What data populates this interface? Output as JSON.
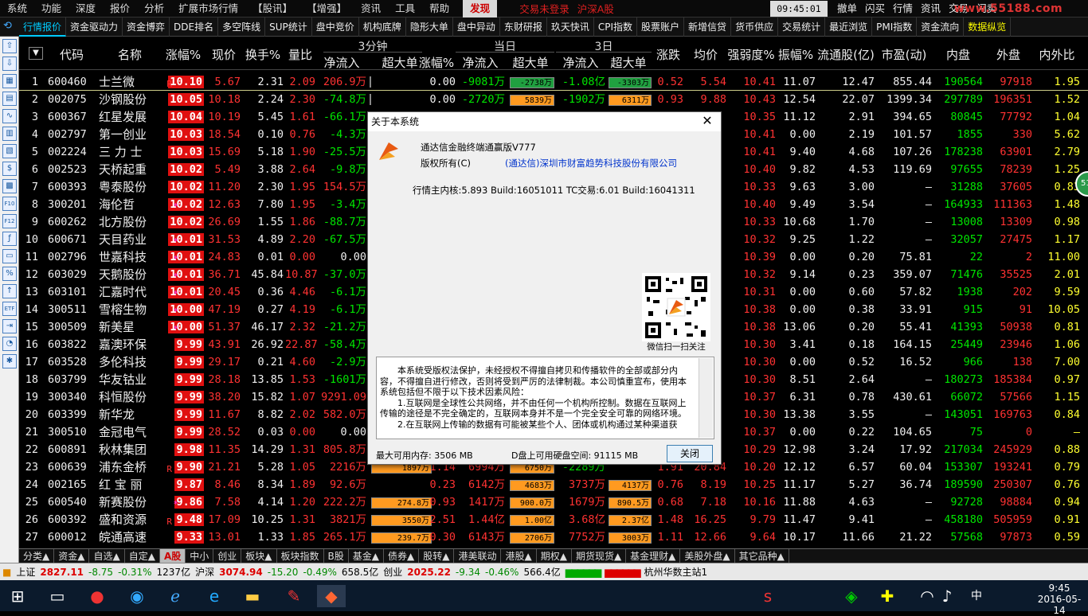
{
  "menubar": {
    "items": [
      "系统",
      "功能",
      "深度",
      "报价",
      "分析",
      "扩展市场行情",
      "【股讯】",
      "【增强】",
      "资讯",
      "工具",
      "帮助"
    ],
    "faxian": "发现",
    "status_login": "交易未登录",
    "status_market": "沪深A股",
    "clock": "09:45:01 周六",
    "right_buttons": [
      "撤单",
      "闪买",
      "行情",
      "资讯",
      "交易",
      "闪卖"
    ],
    "logo": "www.55188.com"
  },
  "tabs": [
    "行情报价",
    "资金驱动力",
    "资金博弈",
    "DDE排名",
    "多空阵线",
    "SUP统计",
    "盘中竞价",
    "机构底牌",
    "隐形大单",
    "盘中异动",
    "东财研报",
    "玖天快讯",
    "CPI指数",
    "股票账户",
    "新增信贷",
    "货币供应",
    "交易统计",
    "最近浏览",
    "PMI指数",
    "资金流向",
    "数据纵览"
  ],
  "left_icons": [
    "up-arrow",
    "down-arrow",
    "chart",
    "table",
    "line",
    "bars",
    "doc",
    "fund",
    "grid",
    "f10",
    "f12",
    "fdo",
    "folder",
    "ratio",
    "bars2",
    "etf",
    "exit",
    "hat",
    "gear"
  ],
  "groups": {
    "g3": "3分钟",
    "gday": "当日",
    "g3d": "3日"
  },
  "columns": [
    "代码",
    "名称",
    "涨幅%",
    "现价",
    "换手%",
    "量比",
    "净流入",
    "超大单",
    "涨幅%",
    "净流入",
    "超大单",
    "净流入",
    "超大单",
    "涨跌",
    "均价",
    "强弱度%",
    "振幅%",
    "流通股(亿)",
    "市盈(动)",
    "内盘",
    "外盘",
    "内外比"
  ],
  "rows": [
    {
      "n": "1",
      "code": "600460",
      "name": "士兰微",
      "flag": "R",
      "pct": "10.10",
      "price": "5.67",
      "turn": "2.31",
      "vr": "2.09",
      "in3": "206.9万",
      "big3": "",
      "p3": "0.00",
      "inD": "-9081万",
      "bigD": "-2738万",
      "in3d": "-1.08亿",
      "big3d": "-3303万",
      "chg": "0.52",
      "avg": "5.54",
      "str": "10.41",
      "amp": "11.07",
      "fl": "12.47",
      "pe": "855.44",
      "inner": "190564",
      "outer": "97918",
      "ratio": "1.95"
    },
    {
      "n": "2",
      "code": "002075",
      "name": "沙钢股份",
      "flag": "",
      "pct": "10.05",
      "price": "10.18",
      "turn": "2.24",
      "vr": "2.30",
      "in3": "-74.8万",
      "big3": "",
      "p3": "0.00",
      "inD": "-2720万",
      "bigD": "5839万",
      "in3d": "-1902万",
      "big3d": "6311万",
      "chg": "0.93",
      "avg": "9.88",
      "str": "10.43",
      "amp": "12.54",
      "fl": "22.07",
      "pe": "1399.34",
      "inner": "297789",
      "outer": "196351",
      "ratio": "1.52"
    },
    {
      "n": "3",
      "code": "600367",
      "name": "红星发展",
      "flag": "",
      "pct": "10.04",
      "price": "10.19",
      "turn": "5.45",
      "vr": "1.61",
      "in3": "-66.1万",
      "big3": "",
      "p3": "",
      "inD": "",
      "bigD": "",
      "in3d": "",
      "big3d": "",
      "chg": "",
      "avg": "",
      "str": "10.35",
      "amp": "11.12",
      "fl": "2.91",
      "pe": "394.65",
      "inner": "80845",
      "outer": "77792",
      "ratio": "1.04"
    },
    {
      "n": "4",
      "code": "002797",
      "name": "第一创业",
      "flag": "",
      "pct": "10.03",
      "price": "18.54",
      "turn": "0.10",
      "vr": "0.76",
      "in3": "-4.3万",
      "big3": "",
      "p3": "",
      "inD": "",
      "bigD": "",
      "in3d": "",
      "big3d": "",
      "chg": "",
      "avg": "",
      "str": "10.41",
      "amp": "0.00",
      "fl": "2.19",
      "pe": "101.57",
      "inner": "1855",
      "outer": "330",
      "ratio": "5.62"
    },
    {
      "n": "5",
      "code": "002224",
      "name": "三 力 士",
      "flag": "",
      "pct": "10.03",
      "price": "15.69",
      "turn": "5.18",
      "vr": "1.90",
      "in3": "-25.5万",
      "big3": "",
      "p3": "",
      "inD": "",
      "bigD": "",
      "in3d": "",
      "big3d": "",
      "chg": "",
      "avg": "",
      "str": "10.41",
      "amp": "9.40",
      "fl": "4.68",
      "pe": "107.26",
      "inner": "178238",
      "outer": "63901",
      "ratio": "2.79"
    },
    {
      "n": "6",
      "code": "002523",
      "name": "天桥起重",
      "flag": "",
      "pct": "10.02",
      "price": "5.49",
      "turn": "3.88",
      "vr": "2.64",
      "in3": "-9.8万",
      "big3": "",
      "p3": "",
      "inD": "",
      "bigD": "",
      "in3d": "",
      "big3d": "",
      "chg": "",
      "avg": "",
      "str": "10.40",
      "amp": "9.82",
      "fl": "4.53",
      "pe": "119.69",
      "inner": "97655",
      "outer": "78239",
      "ratio": "1.25"
    },
    {
      "n": "7",
      "code": "600393",
      "name": "粤泰股份",
      "flag": "",
      "pct": "10.02",
      "price": "11.20",
      "turn": "2.30",
      "vr": "1.95",
      "in3": "154.5万",
      "big3": "",
      "p3": "",
      "inD": "",
      "bigD": "",
      "in3d": "",
      "big3d": "",
      "chg": "",
      "avg": "",
      "str": "10.33",
      "amp": "9.63",
      "fl": "3.00",
      "pe": "—",
      "inner": "31288",
      "outer": "37605",
      "ratio": "0.83"
    },
    {
      "n": "8",
      "code": "300201",
      "name": "海伦哲",
      "flag": "*",
      "pct": "10.02",
      "price": "12.63",
      "turn": "7.80",
      "vr": "1.95",
      "in3": "-3.4万",
      "big3": "",
      "p3": "",
      "inD": "",
      "bigD": "",
      "in3d": "",
      "big3d": "",
      "chg": "",
      "avg": "",
      "str": "10.40",
      "amp": "9.49",
      "fl": "3.54",
      "pe": "—",
      "inner": "164933",
      "outer": "111363",
      "ratio": "1.48"
    },
    {
      "n": "9",
      "code": "600262",
      "name": "北方股份",
      "flag": "",
      "pct": "10.02",
      "price": "26.69",
      "turn": "1.55",
      "vr": "1.86",
      "in3": "-88.7万",
      "big3": "",
      "p3": "",
      "inD": "",
      "bigD": "",
      "in3d": "",
      "big3d": "",
      "chg": "",
      "avg": "",
      "str": "10.33",
      "amp": "10.68",
      "fl": "1.70",
      "pe": "—",
      "inner": "13008",
      "outer": "13309",
      "ratio": "0.98"
    },
    {
      "n": "10",
      "code": "600671",
      "name": "天目药业",
      "flag": "*",
      "pct": "10.01",
      "price": "31.53",
      "turn": "4.89",
      "vr": "2.20",
      "in3": "-67.5万",
      "big3": "",
      "p3": "",
      "inD": "",
      "bigD": "",
      "in3d": "",
      "big3d": "",
      "chg": "",
      "avg": "",
      "str": "10.32",
      "amp": "9.25",
      "fl": "1.22",
      "pe": "—",
      "inner": "32057",
      "outer": "27475",
      "ratio": "1.17"
    },
    {
      "n": "11",
      "code": "002796",
      "name": "世嘉科技",
      "flag": "*",
      "pct": "10.01",
      "price": "24.83",
      "turn": "0.01",
      "vr": "0.00",
      "in3": "0.00",
      "big3": "",
      "p3": "",
      "inD": "",
      "bigD": "",
      "in3d": "",
      "big3d": "",
      "chg": "",
      "avg": "",
      "str": "10.39",
      "amp": "0.00",
      "fl": "0.20",
      "pe": "75.81",
      "inner": "22",
      "outer": "2",
      "ratio": "11.00"
    },
    {
      "n": "12",
      "code": "603029",
      "name": "天鹅股份",
      "flag": "*",
      "pct": "10.01",
      "price": "36.71",
      "turn": "45.84",
      "vr": "10.87",
      "in3": "-37.0万",
      "big3": "",
      "p3": "",
      "inD": "",
      "bigD": "",
      "in3d": "",
      "big3d": "",
      "chg": "",
      "avg": "",
      "str": "10.32",
      "amp": "9.14",
      "fl": "0.23",
      "pe": "359.07",
      "inner": "71476",
      "outer": "35525",
      "ratio": "2.01"
    },
    {
      "n": "13",
      "code": "603101",
      "name": "汇嘉时代",
      "flag": "*",
      "pct": "10.01",
      "price": "20.45",
      "turn": "0.36",
      "vr": "4.46",
      "in3": "-6.1万",
      "big3": "",
      "p3": "",
      "inD": "",
      "bigD": "",
      "in3d": "",
      "big3d": "",
      "chg": "",
      "avg": "",
      "str": "10.31",
      "amp": "0.00",
      "fl": "0.60",
      "pe": "57.82",
      "inner": "1938",
      "outer": "202",
      "ratio": "9.59"
    },
    {
      "n": "14",
      "code": "300511",
      "name": "雪榕生物",
      "flag": "*",
      "pct": "10.00",
      "price": "47.19",
      "turn": "0.27",
      "vr": "4.19",
      "in3": "-6.1万",
      "big3": "",
      "p3": "",
      "inD": "",
      "bigD": "",
      "in3d": "",
      "big3d": "",
      "chg": "",
      "avg": "",
      "str": "10.38",
      "amp": "0.00",
      "fl": "0.38",
      "pe": "33.91",
      "inner": "915",
      "outer": "91",
      "ratio": "10.05"
    },
    {
      "n": "15",
      "code": "300509",
      "name": "新美星",
      "flag": "*",
      "pct": "10.00",
      "price": "51.37",
      "turn": "46.17",
      "vr": "2.32",
      "in3": "-21.2万",
      "big3": "",
      "p3": "",
      "inD": "",
      "bigD": "",
      "in3d": "",
      "big3d": "",
      "chg": "",
      "avg": "",
      "str": "10.38",
      "amp": "13.06",
      "fl": "0.20",
      "pe": "55.41",
      "inner": "41393",
      "outer": "50938",
      "ratio": "0.81"
    },
    {
      "n": "16",
      "code": "603822",
      "name": "嘉澳环保",
      "flag": "",
      "pct": "9.99",
      "price": "43.91",
      "turn": "26.92",
      "vr": "22.87",
      "in3": "-58.4万",
      "big3": "",
      "p3": "",
      "inD": "",
      "bigD": "",
      "in3d": "",
      "big3d": "",
      "chg": "",
      "avg": "",
      "str": "10.30",
      "amp": "3.41",
      "fl": "0.18",
      "pe": "164.15",
      "inner": "25449",
      "outer": "23946",
      "ratio": "1.06"
    },
    {
      "n": "17",
      "code": "603528",
      "name": "多伦科技",
      "flag": "",
      "pct": "9.99",
      "price": "29.17",
      "turn": "0.21",
      "vr": "4.60",
      "in3": "-2.9万",
      "big3": "",
      "p3": "",
      "inD": "",
      "bigD": "",
      "in3d": "",
      "big3d": "",
      "chg": "",
      "avg": "",
      "str": "10.30",
      "amp": "0.00",
      "fl": "0.52",
      "pe": "16.52",
      "inner": "966",
      "outer": "138",
      "ratio": "7.00"
    },
    {
      "n": "18",
      "code": "603799",
      "name": "华友钴业",
      "flag": "",
      "pct": "9.99",
      "price": "28.18",
      "turn": "13.85",
      "vr": "1.53",
      "in3": "-1601万",
      "big3": "",
      "p3": "",
      "inD": "",
      "bigD": "",
      "in3d": "",
      "big3d": "",
      "chg": "",
      "avg": "",
      "str": "10.30",
      "amp": "8.51",
      "fl": "2.64",
      "pe": "—",
      "inner": "180273",
      "outer": "185384",
      "ratio": "0.97"
    },
    {
      "n": "19",
      "code": "300340",
      "name": "科恒股份",
      "flag": "",
      "pct": "9.99",
      "price": "38.20",
      "turn": "15.82",
      "vr": "1.07",
      "in3": "9291.09",
      "big3": "",
      "p3": "",
      "inD": "",
      "bigD": "",
      "in3d": "",
      "big3d": "",
      "chg": "",
      "avg": "",
      "str": "10.37",
      "amp": "6.31",
      "fl": "0.78",
      "pe": "430.61",
      "inner": "66072",
      "outer": "57566",
      "ratio": "1.15"
    },
    {
      "n": "20",
      "code": "603399",
      "name": "新华龙",
      "flag": "",
      "pct": "9.99",
      "price": "11.67",
      "turn": "8.82",
      "vr": "2.02",
      "in3": "582.0万",
      "big3": "",
      "p3": "",
      "inD": "",
      "bigD": "",
      "in3d": "",
      "big3d": "",
      "chg": "",
      "avg": "",
      "str": "10.30",
      "amp": "13.38",
      "fl": "3.55",
      "pe": "—",
      "inner": "143051",
      "outer": "169763",
      "ratio": "0.84"
    },
    {
      "n": "21",
      "code": "300510",
      "name": "金冠电气",
      "flag": "",
      "pct": "9.99",
      "price": "28.52",
      "turn": "0.03",
      "vr": "0.00",
      "in3": "0.00",
      "big3": "",
      "p3": "",
      "inD": "",
      "bigD": "",
      "in3d": "",
      "big3d": "",
      "chg": "",
      "avg": "",
      "str": "10.37",
      "amp": "0.00",
      "fl": "0.22",
      "pe": "104.65",
      "inner": "75",
      "outer": "0",
      "ratio": "—"
    },
    {
      "n": "22",
      "code": "600891",
      "name": "秋林集团",
      "flag": "",
      "pct": "9.98",
      "price": "11.35",
      "turn": "14.29",
      "vr": "1.31",
      "in3": "805.8万",
      "big3": "",
      "p3": "",
      "inD": "",
      "bigD": "",
      "in3d": "",
      "big3d": "",
      "chg": "",
      "avg": "",
      "str": "10.29",
      "amp": "12.98",
      "fl": "3.24",
      "pe": "17.92",
      "inner": "217034",
      "outer": "245929",
      "ratio": "0.88"
    },
    {
      "n": "23",
      "code": "600639",
      "name": "浦东金桥",
      "flag": "R",
      "pct": "9.90",
      "price": "21.21",
      "turn": "5.28",
      "vr": "1.05",
      "in3": "2216万",
      "big3": "1897万",
      "p3": "1.14",
      "inD": "6994万",
      "bigD": "6750万",
      "in3d": "-2289万",
      "big3d": "",
      "chg": "1.91",
      "avg": "20.84",
      "str": "10.20",
      "amp": "12.12",
      "fl": "6.57",
      "pe": "60.04",
      "inner": "153307",
      "outer": "193241",
      "ratio": "0.79"
    },
    {
      "n": "24",
      "code": "002165",
      "name": "红 宝 丽",
      "flag": "",
      "pct": "9.87",
      "price": "8.46",
      "turn": "8.34",
      "vr": "1.89",
      "in3": "92.6万",
      "big3": "",
      "p3": "0.23",
      "inD": "6142万",
      "bigD": "4683万",
      "in3d": "3737万",
      "big3d": "4137万",
      "chg": "0.76",
      "avg": "8.19",
      "str": "10.25",
      "amp": "11.17",
      "fl": "5.27",
      "pe": "36.74",
      "inner": "189590",
      "outer": "250307",
      "ratio": "0.76"
    },
    {
      "n": "25",
      "code": "600540",
      "name": "新赛股份",
      "flag": "*",
      "pct": "9.86",
      "price": "7.58",
      "turn": "4.14",
      "vr": "1.20",
      "in3": "222.2万",
      "big3": "274.8万",
      "p3": "0.93",
      "inD": "1417万",
      "bigD": "900.0万",
      "in3d": "1679万",
      "big3d": "890.5万",
      "chg": "0.68",
      "avg": "7.18",
      "str": "10.16",
      "amp": "11.88",
      "fl": "4.63",
      "pe": "—",
      "inner": "92728",
      "outer": "98884",
      "ratio": "0.94"
    },
    {
      "n": "26",
      "code": "600392",
      "name": "盛和资源",
      "flag": "R",
      "pct": "9.48",
      "price": "17.09",
      "turn": "10.25",
      "vr": "1.31",
      "in3": "3821万",
      "big3": "3550万",
      "p3": "2.51",
      "inD": "1.44亿",
      "bigD": "1.00亿",
      "in3d": "3.68亿",
      "big3d": "2.37亿",
      "chg": "1.48",
      "avg": "16.25",
      "str": "9.79",
      "amp": "11.47",
      "fl": "9.41",
      "pe": "—",
      "inner": "458180",
      "outer": "505959",
      "ratio": "0.91"
    },
    {
      "n": "27",
      "code": "600012",
      "name": "皖通高速",
      "flag": "",
      "pct": "9.33",
      "price": "13.01",
      "turn": "1.33",
      "vr": "1.85",
      "in3": "265.1万",
      "big3": "239.7万",
      "p3": "0.30",
      "inD": "6143万",
      "bigD": "2706万",
      "in3d": "7752万",
      "big3d": "3003万",
      "chg": "1.11",
      "avg": "12.66",
      "str": "9.64",
      "amp": "10.17",
      "fl": "11.66",
      "pe": "21.22",
      "inner": "57568",
      "outer": "97873",
      "ratio": "0.59"
    }
  ],
  "bottom_tabs": [
    "分类▲",
    "资金▲",
    "自选▲",
    "自定▲",
    "A股",
    "中小",
    "创业",
    "板块▲",
    "板块指数",
    "B股",
    "基金▲",
    "债券▲",
    "股转▲",
    "港美联动",
    "港股▲",
    "期权▲",
    "期货现货▲",
    "基金理财▲",
    "美股外盘▲",
    "其它品种▲"
  ],
  "statusbar": {
    "sh_label": "上证",
    "sh_val": "2827.11",
    "sh_chg": "-8.75",
    "sh_pct": "-0.31%",
    "sh_amt": "1237亿",
    "hs_label": "沪深",
    "hs_val": "3074.94",
    "hs_chg": "-15.20",
    "hs_pct": "-0.49%",
    "hs_amt": "658.5亿",
    "cy_label": "创业",
    "cy_val": "2025.22",
    "cy_chg": "-9.34",
    "cy_pct": "-0.46%",
    "cy_amt": "566.4亿",
    "server": "杭州华数主站1"
  },
  "dialog": {
    "title": "关于本系统",
    "product": "通达信金融终端通赢版V777",
    "copyright": "版权所有(C)",
    "company": "(通达信)深圳市财富趋势科技股份有限公司",
    "version": "行情主内核:5.893 Build:16051011 TC交易:6.01 Build:16041311",
    "qr_label": "微信扫一扫关注",
    "legal_p1": "本系统受版权法保护，未经授权不得擅自拷贝和传播软件的全部或部分内容，不得擅自进行修改，否则将受到严厉的法律制裁。本公司慎重宣布，使用本系统包括但不限于以下技术因素风险：",
    "legal_p2": "1.互联网是全球性公共网络，并不由任何一个机构所控制。数据在互联网上传输的途径是不完全确定的，互联网本身并不是一个完全安全可靠的网络环境。",
    "legal_p3": "2.在互联网上传输的数据有可能被某些个人、团体或机构通过某种渠道获",
    "mem": "最大可用内存:  3506 MB",
    "disk": "D盘上可用硬盘空间:  91115 MB",
    "close_btn": "关闭"
  },
  "taskbar": {
    "time": "9:45",
    "date": "2016-05-14",
    "ime": "中"
  },
  "side_badge": "51"
}
